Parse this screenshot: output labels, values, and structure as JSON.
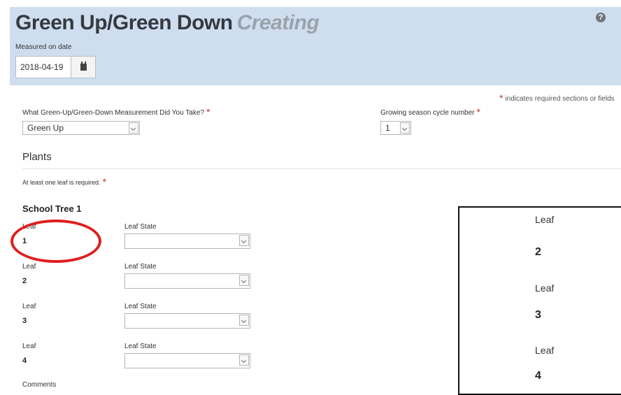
{
  "header": {
    "title": "Green Up/Green Down",
    "status": "Creating",
    "help_icon_glyph": "?",
    "measured_label": "Measured on date",
    "date_value": "2018-04-19"
  },
  "required_note": {
    "star": "*",
    "text": "indicates required sections or fields"
  },
  "measurement": {
    "label": "What Green-Up/Green-Down Measurement Did You Take?",
    "star": "*",
    "selected": "Green Up"
  },
  "cycle": {
    "label": "Growing season cycle number",
    "star": "*",
    "selected": "1"
  },
  "plants": {
    "section_title": "Plants",
    "leaf_required_text": "At least one leaf is required.",
    "leaf_required_star": "*",
    "tree_title": "School Tree 1",
    "leaf_label": "Leaf",
    "state_label": "Leaf State",
    "leaves": [
      {
        "number": "1",
        "state": ""
      },
      {
        "number": "2",
        "state": ""
      },
      {
        "number": "3",
        "state": ""
      },
      {
        "number": "4",
        "state": ""
      }
    ],
    "comments_label": "Comments"
  },
  "zoom_inset": {
    "leaf_label": "Leaf",
    "numbers": [
      "2",
      "3",
      "4"
    ]
  },
  "colors": {
    "header_bg": "#cfdeef",
    "required_star": "#c0392b",
    "highlight": "#e01e1e"
  },
  "icons": {
    "help": "question-circle-icon",
    "calendar": "calendar-icon",
    "dropdown": "chevron-down-icon"
  }
}
